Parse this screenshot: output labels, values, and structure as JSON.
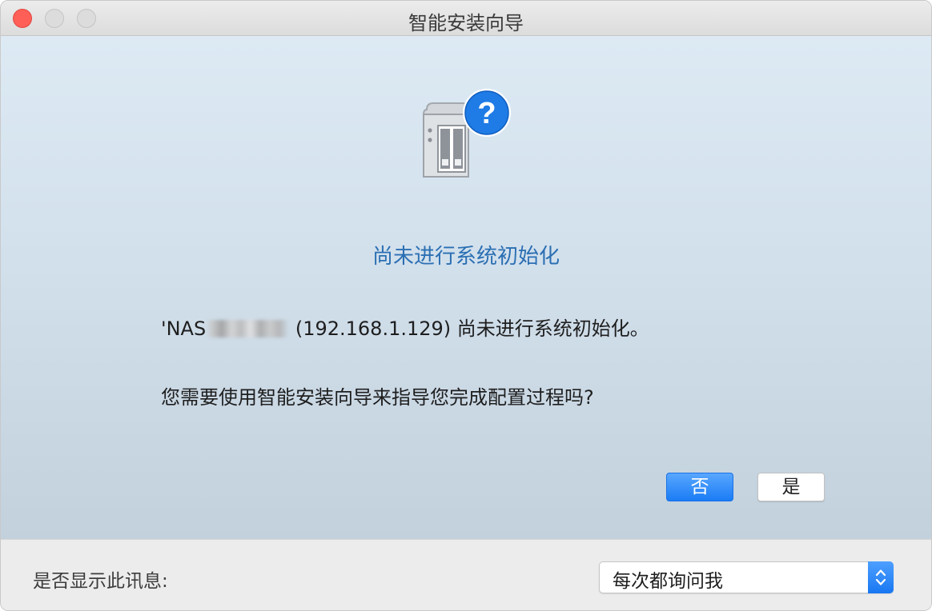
{
  "window": {
    "title": "智能安装向导"
  },
  "dialog": {
    "icon": "nas-question-icon",
    "heading": "尚未进行系统初始化",
    "message_prefix": "'NAS",
    "message_suffix": " (192.168.1.129) 尚未进行系统初始化。",
    "question": "您需要使用智能安装向导来指导您完成配置过程吗?",
    "buttons": {
      "no_label": "否",
      "yes_label": "是"
    }
  },
  "footer": {
    "label": "是否显示此讯息:",
    "select_value": "每次都询问我"
  },
  "colors": {
    "accent": "#1a7cf5",
    "heading": "#2b6fb3",
    "close": "#ff5f57"
  }
}
